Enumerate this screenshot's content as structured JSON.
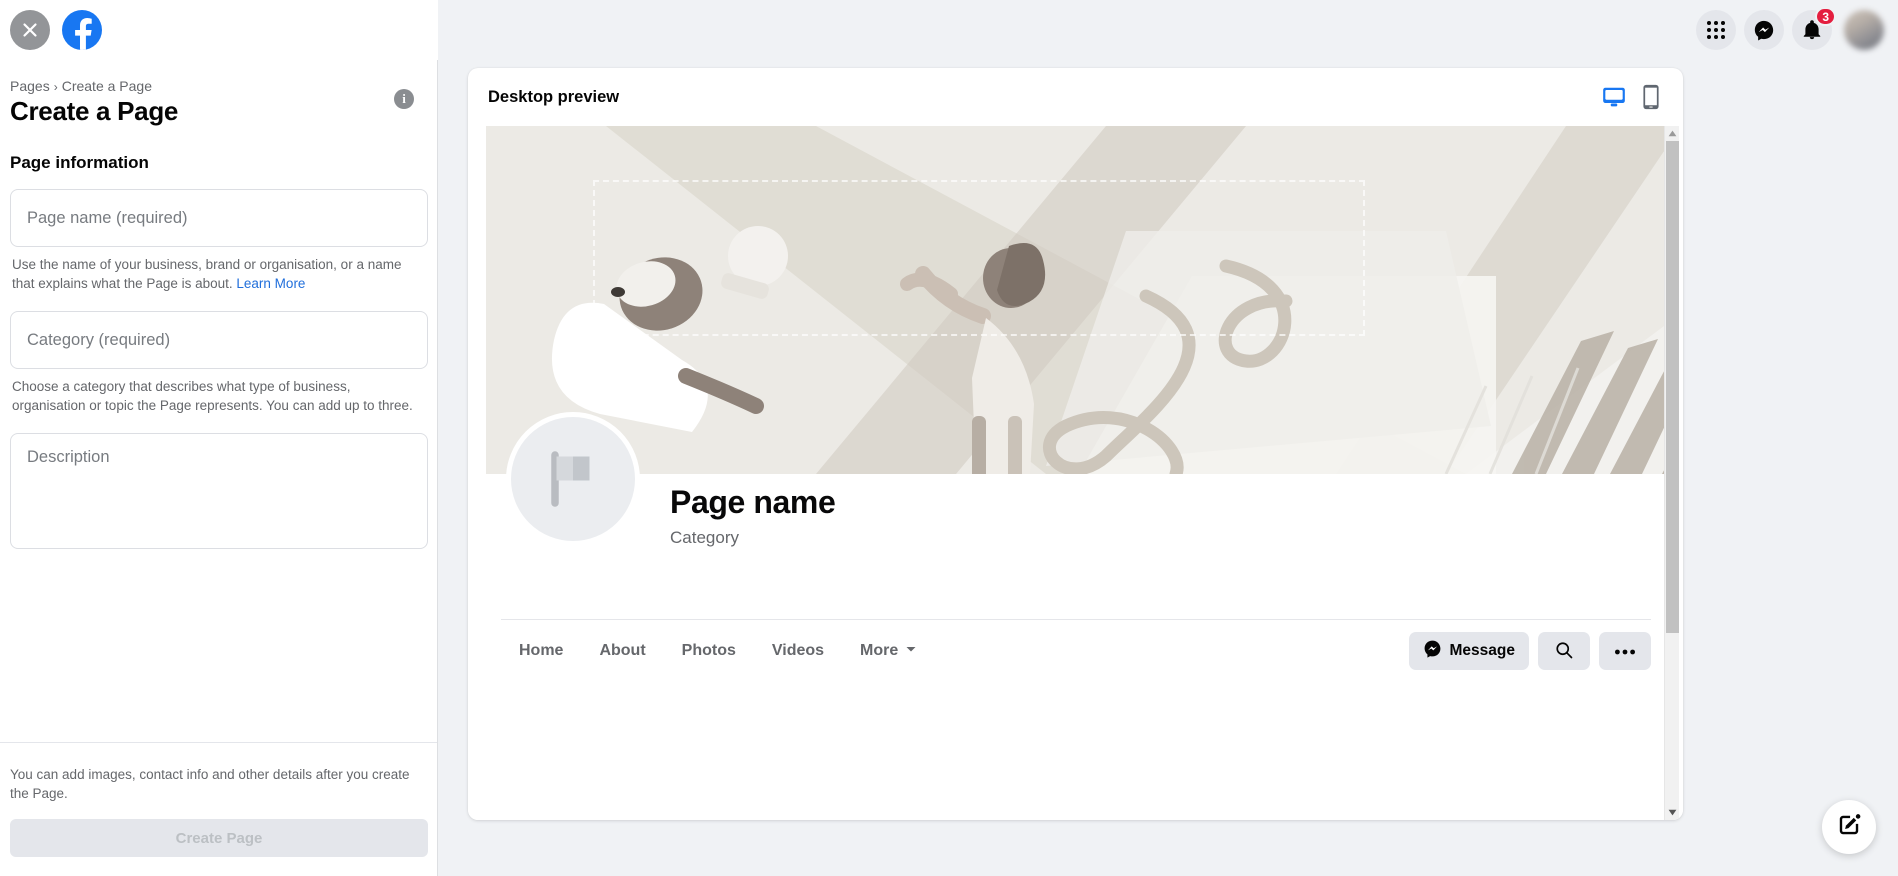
{
  "topbar": {
    "close_label": "close-icon",
    "logo_label": "facebook-logo",
    "menu_label": "menu-grid-icon",
    "messenger_label": "messenger-icon",
    "notifications_label": "notifications-icon",
    "notification_count": "3"
  },
  "sidebar": {
    "breadcrumb_root": "Pages",
    "breadcrumb_separator": "›",
    "breadcrumb_current": "Create a Page",
    "title": "Create a Page",
    "info_glyph": "i",
    "section_title": "Page information",
    "fields": {
      "page_name_placeholder": "Page name (required)",
      "page_name_value": "",
      "page_name_helper": "Use the name of your business, brand or organisation, or a name that explains what the Page is about. ",
      "page_name_helper_link": "Learn More",
      "category_placeholder": "Category (required)",
      "category_value": "",
      "category_helper": "Choose a category that describes what type of business, organisation or topic the Page represents. You can add up to three.",
      "description_placeholder": "Description",
      "description_value": ""
    },
    "footer_note": "You can add images, contact info and other details after you create the Page.",
    "create_button": "Create Page"
  },
  "preview": {
    "header_title": "Desktop preview",
    "desktop_toggle": "desktop-view-icon",
    "mobile_toggle": "mobile-view-icon",
    "desktop_active_color": "#1877f2",
    "mobile_color": "#606770",
    "page_name": "Page name",
    "page_category": "Category",
    "tabs": [
      {
        "label": "Home",
        "has_caret": false
      },
      {
        "label": "About",
        "has_caret": false
      },
      {
        "label": "Photos",
        "has_caret": false
      },
      {
        "label": "Videos",
        "has_caret": false
      },
      {
        "label": "More",
        "has_caret": true
      }
    ],
    "actions": {
      "message_label": "Message",
      "search_label": "search-icon",
      "more_label": "more-options-icon"
    }
  },
  "fab": {
    "label": "compose-icon"
  },
  "colors": {
    "brand_blue": "#1877f2",
    "badge_red": "#e41e3f",
    "page_bg": "#f0f2f5",
    "button_grey": "#e4e6eb",
    "text_secondary": "#65676b",
    "link_blue": "#216fdb"
  }
}
